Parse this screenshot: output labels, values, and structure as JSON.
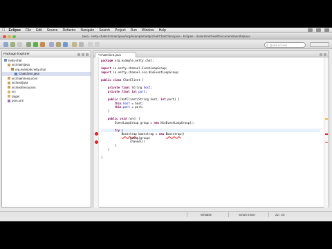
{
  "menubar": {
    "items": [
      "Eclipse",
      "File",
      "Edit",
      "Source",
      "Refactor",
      "Navigate",
      "Search",
      "Project",
      "Run",
      "Window",
      "Help"
    ]
  },
  "window": {
    "title": "Java - netty-chat/src/main/java/org/example/netty/chat/ChatClient.java - Eclipse - /Users/michael/Documents/workspace"
  },
  "toolbar": {
    "search_placeholder": "Quick Access"
  },
  "explorer": {
    "title": "Package Explorer",
    "items": [
      {
        "label": "netty-chat",
        "indent": 0,
        "color": "#6b8cc7"
      },
      {
        "label": "src/main/java",
        "indent": 1,
        "color": "#c7a25a"
      },
      {
        "label": "org.example.netty.chat",
        "indent": 2,
        "color": "#b08a4a"
      },
      {
        "label": "ChatClient.java",
        "indent": 3,
        "color": "#5a7ec0",
        "selected": true
      },
      {
        "label": "src/main/resources",
        "indent": 1,
        "color": "#c7a25a"
      },
      {
        "label": "src/test/java",
        "indent": 1,
        "color": "#c7a25a"
      },
      {
        "label": "src/test/resources",
        "indent": 1,
        "color": "#c7a25a"
      },
      {
        "label": "src",
        "indent": 1,
        "color": "#d6b25e"
      },
      {
        "label": "target",
        "indent": 1,
        "color": "#d6b25e"
      },
      {
        "label": "pom.xml",
        "indent": 1,
        "color": "#9a6fb0"
      }
    ]
  },
  "editor": {
    "tab_label": "*ChatClient.java",
    "cursor_line": 18
  },
  "code_lines": [
    [
      {
        "k": "kw",
        "t": "package"
      },
      {
        "t": " org.example.netty.chat;"
      }
    ],
    [],
    [
      {
        "k": "kw",
        "t": "import"
      },
      {
        "t": " io.netty.channel.EventLoopGroup;"
      }
    ],
    [
      {
        "k": "kw",
        "t": "import"
      },
      {
        "t": " io.netty.channel.nio.NioEventLoopGroup;"
      }
    ],
    [],
    [
      {
        "k": "kw",
        "t": "public class"
      },
      {
        "t": " ChatClient {"
      }
    ],
    [],
    [
      {
        "t": "    "
      },
      {
        "k": "kw",
        "t": "private final"
      },
      {
        "t": " String "
      },
      {
        "k": "fld",
        "t": "host"
      },
      {
        "t": ";"
      }
    ],
    [
      {
        "t": "    "
      },
      {
        "k": "kw",
        "t": "private final int"
      },
      {
        "t": " "
      },
      {
        "k": "fld",
        "t": "port"
      },
      {
        "t": ";"
      }
    ],
    [],
    [
      {
        "t": "    "
      },
      {
        "k": "kw",
        "t": "public"
      },
      {
        "t": " ChatClient(String host, "
      },
      {
        "k": "kw",
        "t": "int"
      },
      {
        "t": " port) {"
      }
    ],
    [
      {
        "t": "        "
      },
      {
        "k": "kw",
        "t": "this"
      },
      {
        "t": "."
      },
      {
        "k": "fld",
        "t": "host"
      },
      {
        "t": " = host;"
      }
    ],
    [
      {
        "t": "        "
      },
      {
        "k": "kw",
        "t": "this"
      },
      {
        "t": "."
      },
      {
        "k": "fld",
        "t": "port"
      },
      {
        "t": " = port;"
      }
    ],
    [
      {
        "t": "    }"
      }
    ],
    [],
    [
      {
        "t": "    "
      },
      {
        "k": "kw",
        "t": "public void"
      },
      {
        "t": " run() {"
      }
    ],
    [
      {
        "t": "        EventLoopGroup group = "
      },
      {
        "k": "kw",
        "t": "new"
      },
      {
        "t": " NioEventLoopGroup();"
      }
    ],
    [],
    [
      {
        "t": "        "
      },
      {
        "k": "kw",
        "t": "try"
      },
      {
        "t": " {"
      }
    ],
    [
      {
        "t": "            "
      },
      {
        "k": "err",
        "t": "Bootstrap"
      },
      {
        "t": " bootstrap = "
      },
      {
        "k": "kw",
        "t": "new"
      },
      {
        "t": " "
      },
      {
        "k": "err",
        "t": "Bootstrap"
      },
      {
        "t": "()"
      }
    ],
    [
      {
        "t": "                .group(group)"
      }
    ],
    [
      {
        "t": "                .channel()"
      }
    ],
    [
      {
        "t": "        }"
      }
    ],
    [
      {
        "t": "    }"
      }
    ],
    [],
    [
      {
        "t": "}"
      }
    ]
  ],
  "statusbar": {
    "writable": "Writable",
    "insert_mode": "Smart Insert",
    "position": "22 : 23"
  },
  "colors": {
    "error": "#e22222",
    "keyword": "#7f0055",
    "field": "#0000c0",
    "selection": "#d7dff0"
  }
}
